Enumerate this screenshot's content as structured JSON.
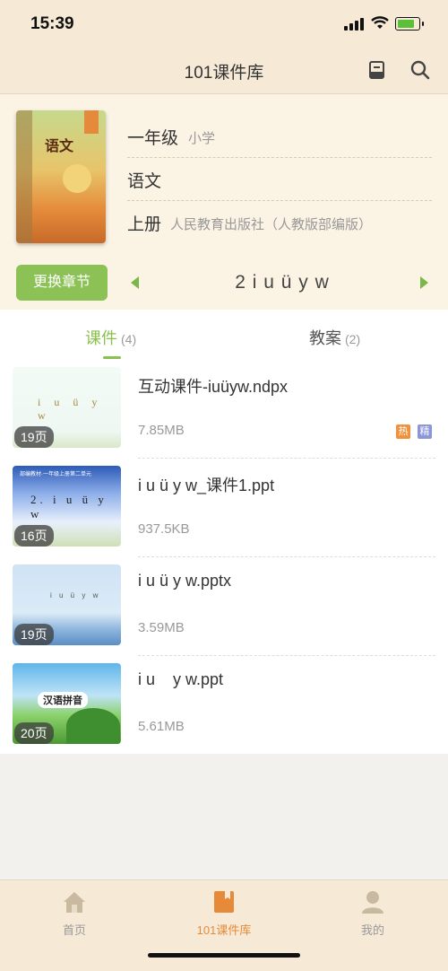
{
  "status_bar": {
    "time": "15:39"
  },
  "nav": {
    "title": "101课件库"
  },
  "book": {
    "grade": "一年级",
    "level": "小学",
    "subject": "语文",
    "volume": "上册",
    "publisher": "人民教育出版社（人教版部编版）",
    "cover_title": "语文"
  },
  "chapter": {
    "change_label": "更换章节",
    "current": "2 i u ü y w"
  },
  "tabs": [
    {
      "label": "课件",
      "count": "(4)",
      "active": true
    },
    {
      "label": "教案",
      "count": "(2)",
      "active": false
    }
  ],
  "items": [
    {
      "name": "互动课件-iuüyw.ndpx",
      "size": "7.85MB",
      "pages": "19页",
      "thumb_text": "i u ü y w",
      "badges": [
        "热",
        "精"
      ]
    },
    {
      "name": "i u ü y w_课件1.ppt",
      "size": "937.5KB",
      "pages": "16页",
      "thumb_header": "部编教材·一年级上册第二单元",
      "thumb_text": "2. i u ü y w"
    },
    {
      "name": "i u ü y w.pptx",
      "size": "3.59MB",
      "pages": "19页",
      "thumb_text": "i u ü y w"
    },
    {
      "name": "i u    y w.ppt",
      "size": "5.61MB",
      "pages": "20页",
      "thumb_text": "汉语拼音"
    }
  ],
  "tabbar": [
    {
      "label": "首页",
      "icon": "home-icon",
      "active": false
    },
    {
      "label": "101课件库",
      "icon": "library-icon",
      "active": true
    },
    {
      "label": "我的",
      "icon": "profile-icon",
      "active": false
    }
  ],
  "colors": {
    "accent": "#8ac14e",
    "tabbar_active": "#e68a3a",
    "badge_hot": "#f0913b",
    "badge_fine": "#8a96d6"
  }
}
